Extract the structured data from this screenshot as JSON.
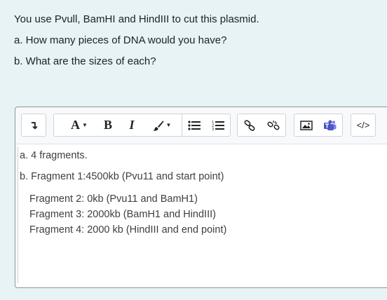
{
  "question": {
    "title": "You use Pvull, BamHI and HindIII to cut this plasmid.",
    "part_a": "a. How many pieces of DNA would you have?",
    "part_b": "b. What are the sizes of each?"
  },
  "toolbar": {
    "paragraph_glyph": "↴",
    "font_label": "A",
    "bold_label": "B",
    "italic_label": "I",
    "code_label": "</>"
  },
  "answer": {
    "line1": "a. 4 fragments.",
    "line2": "b. Fragment 1:4500kb (Pvu11 and start point)",
    "line3": "Fragment 2: 0kb (Pvu11 and BamH1)",
    "line4": "Fragment 3: 2000kb (BamH1 and HindIII)",
    "line5": "Fragment 4: 2000 kb (HindIII and end point)"
  },
  "colors": {
    "page_background": "#e7f3f5",
    "teams_icon": "#5059c9"
  }
}
